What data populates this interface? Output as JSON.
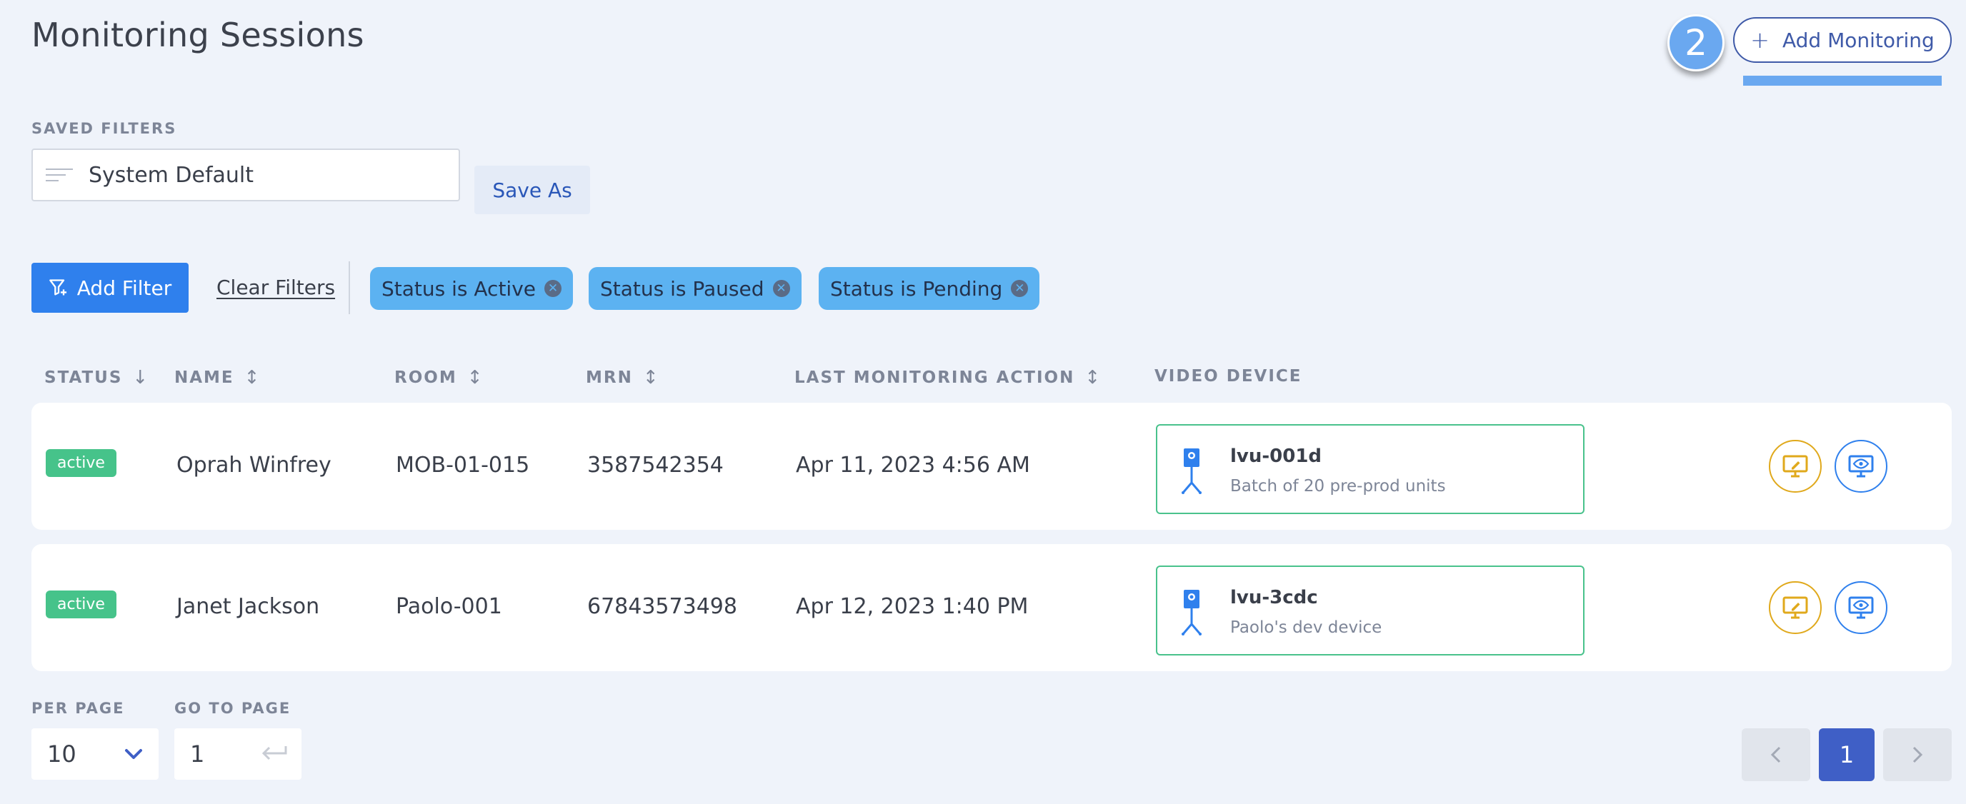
{
  "header": {
    "title": "Monitoring Sessions",
    "step_number": "2",
    "add_monitoring_label": "Add Monitoring"
  },
  "saved_filters": {
    "label": "SAVED FILTERS",
    "selected": "System Default",
    "save_as_label": "Save As"
  },
  "filters": {
    "add_filter_label": "Add Filter",
    "clear_filters_label": "Clear Filters",
    "chips": [
      {
        "label": "Status is Active"
      },
      {
        "label": "Status is Paused"
      },
      {
        "label": "Status is Pending"
      }
    ]
  },
  "table": {
    "columns": {
      "status": "STATUS",
      "name": "NAME",
      "room": "ROOM",
      "mrn": "MRN",
      "last_action": "LAST MONITORING ACTION",
      "video_device": "VIDEO DEVICE"
    },
    "rows": [
      {
        "status": "active",
        "name": "Oprah Winfrey",
        "room": "MOB-01-015",
        "mrn": "3587542354",
        "last_action": "Apr 11, 2023 4:56 AM",
        "device_name": "lvu-001d",
        "device_desc": "Batch of 20 pre-prod units"
      },
      {
        "status": "active",
        "name": "Janet Jackson",
        "room": "Paolo-001",
        "mrn": "67843573498",
        "last_action": "Apr 12, 2023 1:40 PM",
        "device_name": "lvu-3cdc",
        "device_desc": "Paolo's dev device"
      }
    ]
  },
  "pagination": {
    "per_page_label": "PER PAGE",
    "per_page_value": "10",
    "go_to_page_label": "GO TO PAGE",
    "go_to_page_value": "1",
    "current_page": "1"
  },
  "colors": {
    "primary": "#2f80ed",
    "chip": "#5cb2f1",
    "active_badge": "#46c38a",
    "takeover_action": "#e0a91c",
    "view_action": "#2f80ed",
    "page_current": "#3f5fc6"
  },
  "icons": {
    "filter_lines": "filter-lines-icon",
    "add_filter": "filter-add-icon",
    "chip_remove": "close-circle-icon",
    "device": "camera-stand-icon",
    "takeover": "monitor-edit-icon",
    "view": "monitor-eye-icon",
    "per_page_dropdown": "chevron-down-icon",
    "go_to_page_enter": "enter-arrow-icon",
    "prev": "chevron-left-icon",
    "next": "chevron-right-icon"
  }
}
